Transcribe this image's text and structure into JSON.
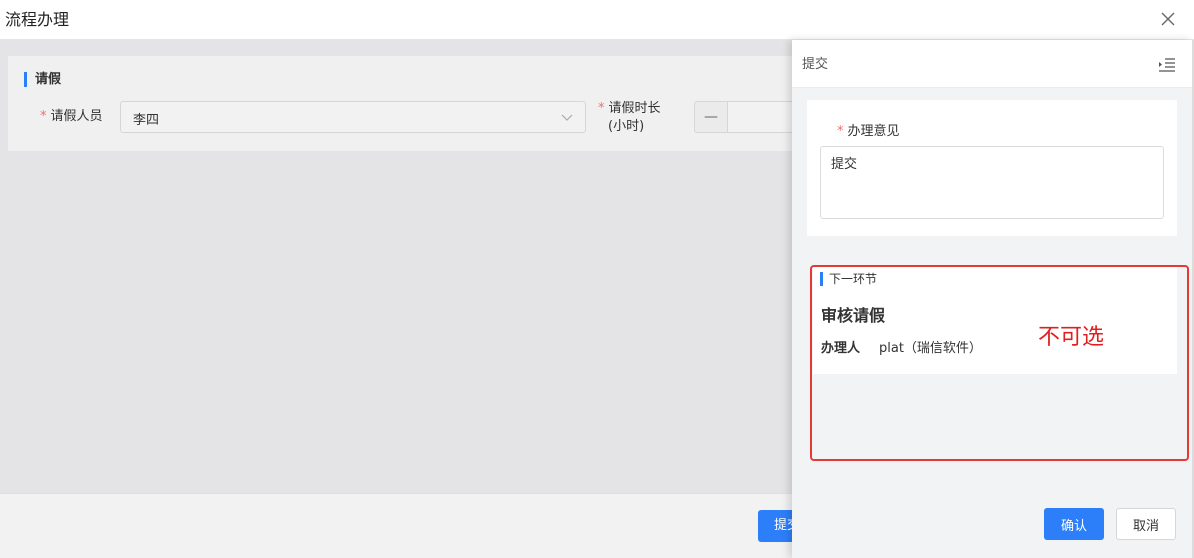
{
  "dialog": {
    "title": "流程办理"
  },
  "form": {
    "section_title": "请假",
    "applicant": {
      "label": "请假人员",
      "value": "李四"
    },
    "duration": {
      "label_line1": "请假时长",
      "label_line2": "(小时)",
      "minus": "—"
    }
  },
  "footer": {
    "submit_label": "提交"
  },
  "drawer": {
    "title": "提交",
    "opinion": {
      "label": "办理意见",
      "value": "提交"
    },
    "next": {
      "section_title": "下一环节",
      "node_name": "审核请假",
      "handler_label": "办理人",
      "handler_value": "plat（瑞信软件）"
    },
    "annotation": "不可选",
    "confirm_label": "确认",
    "cancel_label": "取消"
  },
  "colors": {
    "accent": "#2d7ff9",
    "required": "#f56c6c",
    "annotation": "#e53935"
  },
  "icons": [
    "close-icon",
    "chevron-down-icon",
    "menu-fold-icon",
    "resize-grip-icon"
  ]
}
